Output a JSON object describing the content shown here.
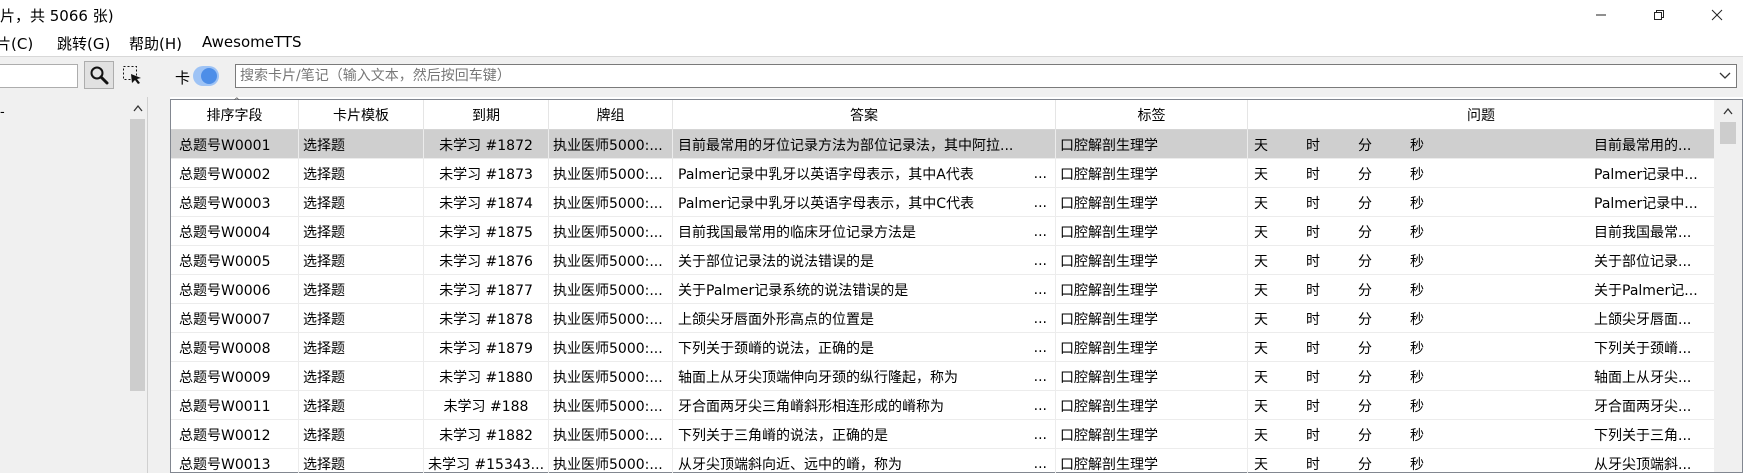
{
  "window": {
    "title": "片，共 5066 张)",
    "minimize_glyph": "—",
    "maximize_glyph": "❐",
    "close_glyph": "✕"
  },
  "menu": {
    "items": [
      {
        "label": "卡片(C)",
        "visible": "片(C)"
      },
      {
        "label": "跳转(G)"
      },
      {
        "label": "帮助(H)"
      },
      {
        "label": "AwesomeTTS"
      }
    ]
  },
  "toolbar": {
    "deck_search_value": "",
    "search_icon": "magnifier-icon",
    "select_icon": "select-region-icon",
    "toggle_label": "卡",
    "search_placeholder": "搜索卡片/笔记（输入文本，然后按回车键）",
    "search_value": ""
  },
  "sidebar": {
    "partial_item": "-"
  },
  "table": {
    "columns": [
      "排序字段",
      "卡片模板",
      "到期",
      "牌组",
      "答案",
      "标签",
      "问题"
    ],
    "sort_indicator": "^",
    "question_parts": [
      "天",
      "时",
      "分",
      "秒"
    ],
    "ellipsis": "...",
    "rows": [
      {
        "sort": "总题号W0001",
        "template": "选择题",
        "due": "未学习 #1872",
        "deck": "执业医师5000:...",
        "answer": "目前最常用的牙位记录方法为部位记录法，其中阿拉...",
        "tag": "口腔解剖生理学",
        "question": "目前最常用的...",
        "selected": true
      },
      {
        "sort": "总题号W0002",
        "template": "选择题",
        "due": "未学习 #1873",
        "deck": "执业医师5000:...",
        "answer": "Palmer记录中乳牙以英语字母表示，其中A代表",
        "tag": "口腔解剖生理学",
        "question": "Palmer记录中..."
      },
      {
        "sort": "总题号W0003",
        "template": "选择题",
        "due": "未学习 #1874",
        "deck": "执业医师5000:...",
        "answer": "Palmer记录中乳牙以英语字母表示，其中C代表",
        "tag": "口腔解剖生理学",
        "question": "Palmer记录中..."
      },
      {
        "sort": "总题号W0004",
        "template": "选择题",
        "due": "未学习 #1875",
        "deck": "执业医师5000:...",
        "answer": "目前我国最常用的临床牙位记录方法是",
        "tag": "口腔解剖生理学",
        "question": "目前我国最常..."
      },
      {
        "sort": "总题号W0005",
        "template": "选择题",
        "due": "未学习 #1876",
        "deck": "执业医师5000:...",
        "answer": "关于部位记录法的说法错误的是",
        "tag": "口腔解剖生理学",
        "question": "关于部位记录..."
      },
      {
        "sort": "总题号W0006",
        "template": "选择题",
        "due": "未学习 #1877",
        "deck": "执业医师5000:...",
        "answer": "关于Palmer记录系统的说法错误的是",
        "tag": "口腔解剖生理学",
        "question": "关于Palmer记..."
      },
      {
        "sort": "总题号W0007",
        "template": "选择题",
        "due": "未学习 #1878",
        "deck": "执业医师5000:...",
        "answer": "上颌尖牙唇面外形高点的位置是",
        "tag": "口腔解剖生理学",
        "question": "上颌尖牙唇面..."
      },
      {
        "sort": "总题号W0008",
        "template": "选择题",
        "due": "未学习 #1879",
        "deck": "执业医师5000:...",
        "answer": "下列关于颈嵴的说法，正确的是",
        "tag": "口腔解剖生理学",
        "question": "下列关于颈嵴..."
      },
      {
        "sort": "总题号W0009",
        "template": "选择题",
        "due": "未学习 #1880",
        "deck": "执业医师5000:...",
        "answer": "轴面上从牙尖顶端伸向牙颈的纵行隆起，称为",
        "tag": "口腔解剖生理学",
        "question": "轴面上从牙尖..."
      },
      {
        "sort": "总题号W0011",
        "template": "选择题",
        "due": "未学习 #188",
        "deck": "执业医师5000:...",
        "answer": "牙合面两牙尖三角嵴斜形相连形成的嵴称为",
        "tag": "口腔解剖生理学",
        "question": "牙合面两牙尖..."
      },
      {
        "sort": "总题号W0012",
        "template": "选择题",
        "due": "未学习 #1882",
        "deck": "执业医师5000:...",
        "answer": "下列关于三角嵴的说法，正确的是",
        "tag": "口腔解剖生理学",
        "question": "下列关于三角..."
      },
      {
        "sort": "总题号W0013",
        "template": "选择题",
        "due": "未学习 #15343...",
        "deck": "执业医师5000:...",
        "answer": "从牙尖顶端斜向近、远中的嵴，称为",
        "tag": "口腔解剖生理学",
        "question": "从牙尖顶端斜..."
      }
    ]
  }
}
